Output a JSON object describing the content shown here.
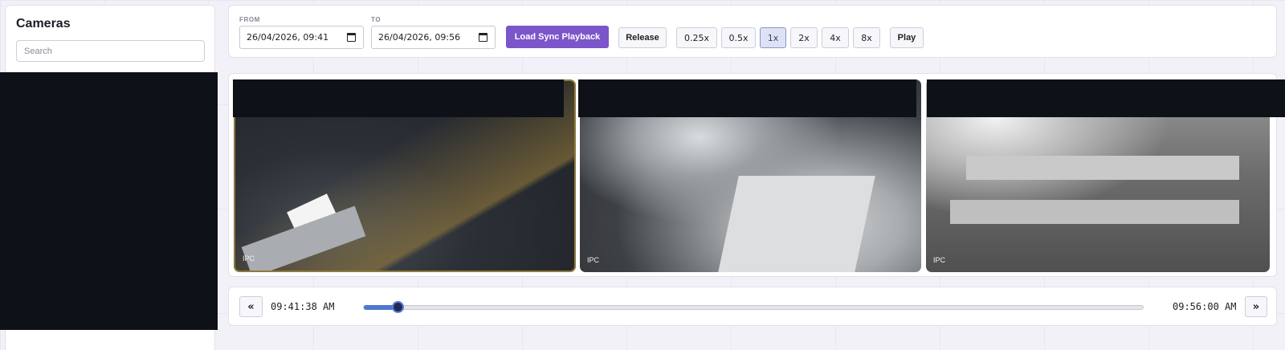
{
  "sidebar": {
    "title": "Cameras",
    "search_placeholder": "Search"
  },
  "toolbar": {
    "from_label": "FROM",
    "from_value": "26/04/2026, 09:41",
    "to_label": "TO",
    "to_value": "26/04/2026, 09:56",
    "load_label": "Load Sync Playback",
    "release_label": "Release",
    "speeds": [
      "0.25x",
      "0.5x",
      "1x",
      "2x",
      "4x",
      "8x"
    ],
    "active_speed": "1x",
    "play_label": "Play",
    "accent_color": "#7b55c9"
  },
  "cameras": [
    {
      "label": "IPC"
    },
    {
      "label": "IPC"
    },
    {
      "label": "IPC"
    }
  ],
  "playback": {
    "prev_label": "«",
    "next_label": "»",
    "current_time": "09:41:38 AM",
    "end_time": "09:56:00 AM",
    "progress_fraction": 0.043
  }
}
